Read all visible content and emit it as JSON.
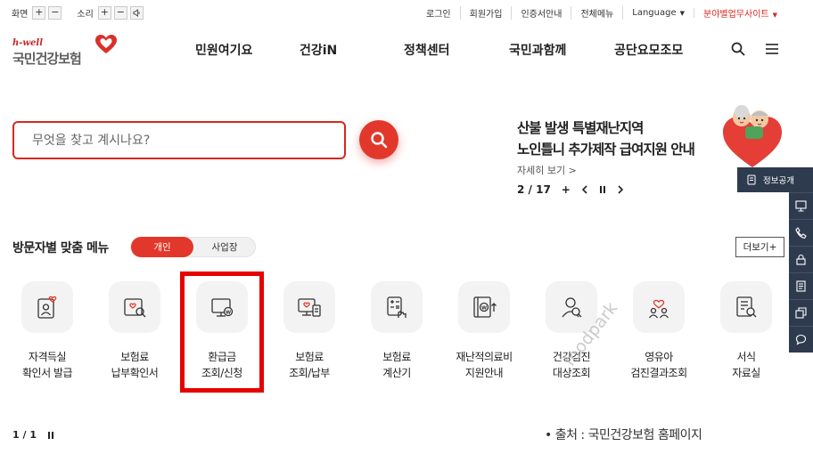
{
  "utility": {
    "screen_label": "화면",
    "sound_label": "소리",
    "plus": "+",
    "minus": "−"
  },
  "top_links": [
    {
      "label": "로그인"
    },
    {
      "label": "회원가입"
    },
    {
      "label": "인증서안내"
    },
    {
      "label": "전체메뉴"
    },
    {
      "label": "Language"
    },
    {
      "label": "분야별업무사이트"
    }
  ],
  "logo": {
    "tagline": "h-well",
    "name": "국민건강보험"
  },
  "gnb": [
    {
      "label": "민원여기요"
    },
    {
      "label": "건강iN"
    },
    {
      "label": "정책센터"
    },
    {
      "label": "국민과함께"
    },
    {
      "label": "공단요모조모"
    }
  ],
  "search": {
    "placeholder": "무엇을 찾고 계시나요?",
    "value": ""
  },
  "banner": {
    "title_line1": "산불 발생 특별재난지역",
    "title_line2": "노인틀니 추가제작 급여지원 안내",
    "more_label": "자세히 보기",
    "page": "2 / 17"
  },
  "quick": {
    "top_label": "정보공개"
  },
  "menu_section": {
    "title": "방문자별 맞춤 메뉴",
    "toggle_on": "개인",
    "toggle_off": "사업장",
    "more_label": "더보기+",
    "items": [
      {
        "line1": "자격득실",
        "line2": "확인서 발급"
      },
      {
        "line1": "보험료",
        "line2": "납부확인서"
      },
      {
        "line1": "환급금",
        "line2": "조회/신청"
      },
      {
        "line1": "보험료",
        "line2": "조회/납부"
      },
      {
        "line1": "보험료",
        "line2": "계산기"
      },
      {
        "line1": "재난적의료비",
        "line2": "지원안내"
      },
      {
        "line1": "건강검진",
        "line2": "대상조회"
      },
      {
        "line1": "영유아",
        "line2": "검진결과조회"
      },
      {
        "line1": "서식",
        "line2": "자료실"
      }
    ],
    "pager": "1 / 1"
  },
  "watermark": "foodpark",
  "caption": "• 출처 : 국민건강보험 홈페이지",
  "colors": {
    "accent": "#e2382b",
    "highlight_box": "#e60000",
    "quickbar": "#2e3b4e"
  }
}
